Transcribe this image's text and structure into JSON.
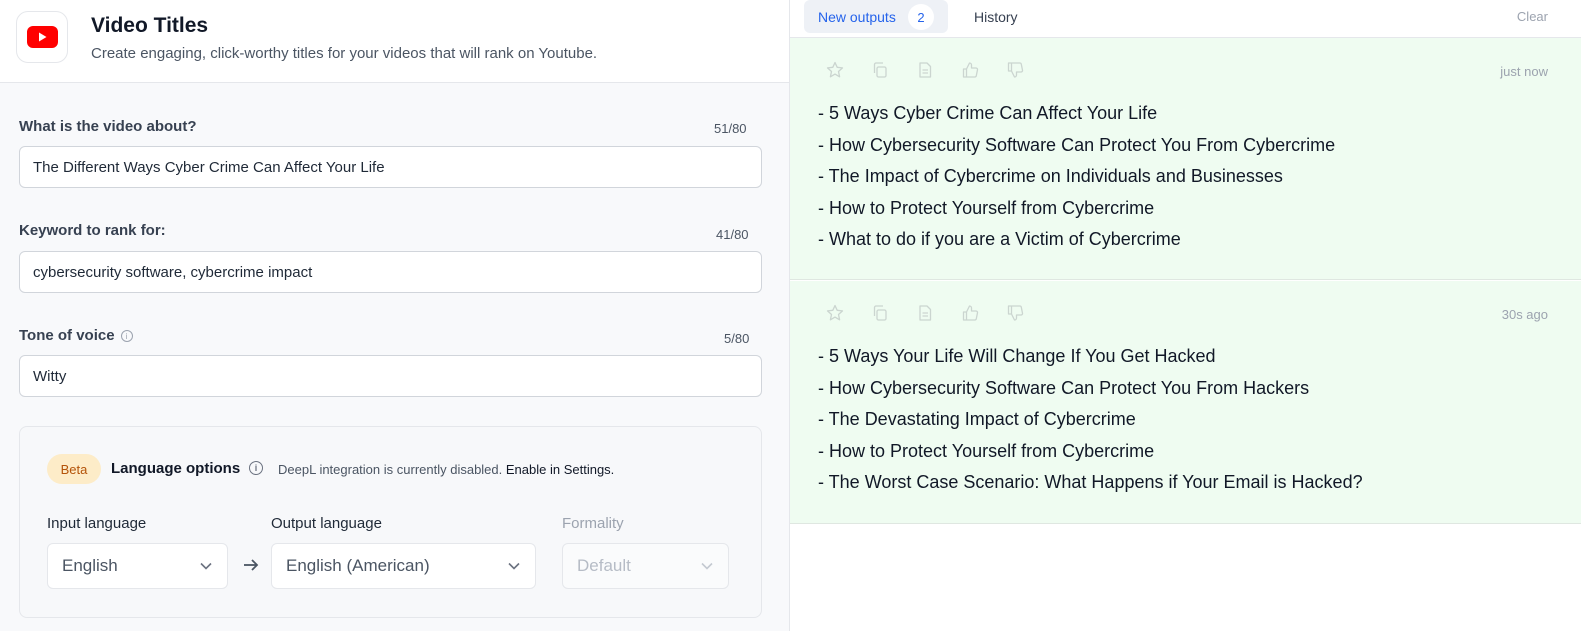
{
  "header": {
    "title": "Video Titles",
    "subtitle": "Create engaging, click-worthy titles for your videos that will rank on Youtube."
  },
  "form": {
    "about": {
      "label": "What is the video about?",
      "count": "51/80",
      "value": "The Different Ways Cyber Crime Can Affect Your Life"
    },
    "keyword": {
      "label": "Keyword to rank for:",
      "count": "41/80",
      "value": "cybersecurity software, cybercrime impact"
    },
    "tone": {
      "label": "Tone of voice",
      "count": "5/80",
      "value": "Witty"
    }
  },
  "language": {
    "badge": "Beta",
    "title": "Language options",
    "note": "DeepL integration is currently disabled.",
    "note_link": "Enable in Settings.",
    "input_label": "Input language",
    "input_value": "English",
    "output_label": "Output language",
    "output_value": "English (American)",
    "formality_label": "Formality",
    "formality_value": "Default"
  },
  "tabs": {
    "new_outputs": "New outputs",
    "new_count": "2",
    "history": "History",
    "clear": "Clear"
  },
  "outputs": [
    {
      "time": "just now",
      "items": [
        "- 5 Ways Cyber Crime Can Affect Your Life",
        "- How Cybersecurity Software Can Protect You From Cybercrime",
        "- The Impact of Cybercrime on Individuals and Businesses",
        "- How to Protect Yourself from Cybercrime",
        "- What to do if you are a Victim of Cybercrime"
      ]
    },
    {
      "time": "30s ago",
      "items": [
        "- 5 Ways Your Life Will Change If You Get Hacked",
        "- How Cybersecurity Software Can Protect You From Hackers",
        "- The Devastating Impact of Cybercrime",
        "- How to Protect Yourself from Cybercrime",
        "- The Worst Case Scenario: What Happens if Your Email is Hacked?"
      ]
    }
  ],
  "colors": {
    "accent": "#2563eb",
    "brand_youtube": "#ff0000",
    "output_bg": "#effcf1",
    "beta_bg": "#fdecc8"
  },
  "icons": [
    "youtube-logo-icon",
    "info-icon",
    "arrow-right-icon",
    "chevron-down-icon",
    "star-icon",
    "copy-icon",
    "document-icon",
    "thumbs-up-icon",
    "thumbs-down-icon"
  ]
}
